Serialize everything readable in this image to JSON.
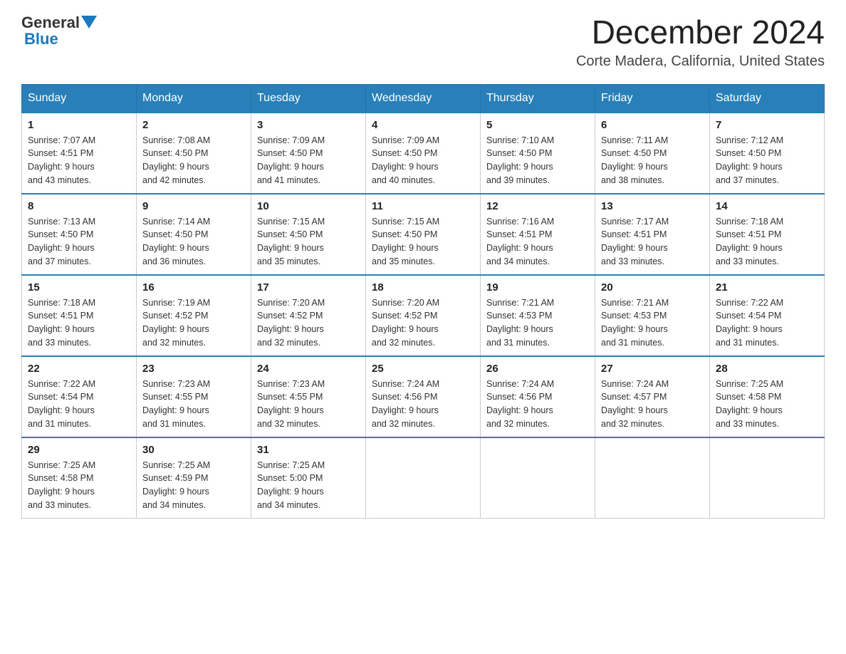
{
  "header": {
    "logo_general": "General",
    "logo_blue": "Blue",
    "main_title": "December 2024",
    "subtitle": "Corte Madera, California, United States"
  },
  "weekdays": [
    "Sunday",
    "Monday",
    "Tuesday",
    "Wednesday",
    "Thursday",
    "Friday",
    "Saturday"
  ],
  "weeks": [
    [
      {
        "day": "1",
        "sunrise": "7:07 AM",
        "sunset": "4:51 PM",
        "daylight": "9 hours and 43 minutes."
      },
      {
        "day": "2",
        "sunrise": "7:08 AM",
        "sunset": "4:50 PM",
        "daylight": "9 hours and 42 minutes."
      },
      {
        "day": "3",
        "sunrise": "7:09 AM",
        "sunset": "4:50 PM",
        "daylight": "9 hours and 41 minutes."
      },
      {
        "day": "4",
        "sunrise": "7:09 AM",
        "sunset": "4:50 PM",
        "daylight": "9 hours and 40 minutes."
      },
      {
        "day": "5",
        "sunrise": "7:10 AM",
        "sunset": "4:50 PM",
        "daylight": "9 hours and 39 minutes."
      },
      {
        "day": "6",
        "sunrise": "7:11 AM",
        "sunset": "4:50 PM",
        "daylight": "9 hours and 38 minutes."
      },
      {
        "day": "7",
        "sunrise": "7:12 AM",
        "sunset": "4:50 PM",
        "daylight": "9 hours and 37 minutes."
      }
    ],
    [
      {
        "day": "8",
        "sunrise": "7:13 AM",
        "sunset": "4:50 PM",
        "daylight": "9 hours and 37 minutes."
      },
      {
        "day": "9",
        "sunrise": "7:14 AM",
        "sunset": "4:50 PM",
        "daylight": "9 hours and 36 minutes."
      },
      {
        "day": "10",
        "sunrise": "7:15 AM",
        "sunset": "4:50 PM",
        "daylight": "9 hours and 35 minutes."
      },
      {
        "day": "11",
        "sunrise": "7:15 AM",
        "sunset": "4:50 PM",
        "daylight": "9 hours and 35 minutes."
      },
      {
        "day": "12",
        "sunrise": "7:16 AM",
        "sunset": "4:51 PM",
        "daylight": "9 hours and 34 minutes."
      },
      {
        "day": "13",
        "sunrise": "7:17 AM",
        "sunset": "4:51 PM",
        "daylight": "9 hours and 33 minutes."
      },
      {
        "day": "14",
        "sunrise": "7:18 AM",
        "sunset": "4:51 PM",
        "daylight": "9 hours and 33 minutes."
      }
    ],
    [
      {
        "day": "15",
        "sunrise": "7:18 AM",
        "sunset": "4:51 PM",
        "daylight": "9 hours and 33 minutes."
      },
      {
        "day": "16",
        "sunrise": "7:19 AM",
        "sunset": "4:52 PM",
        "daylight": "9 hours and 32 minutes."
      },
      {
        "day": "17",
        "sunrise": "7:20 AM",
        "sunset": "4:52 PM",
        "daylight": "9 hours and 32 minutes."
      },
      {
        "day": "18",
        "sunrise": "7:20 AM",
        "sunset": "4:52 PM",
        "daylight": "9 hours and 32 minutes."
      },
      {
        "day": "19",
        "sunrise": "7:21 AM",
        "sunset": "4:53 PM",
        "daylight": "9 hours and 31 minutes."
      },
      {
        "day": "20",
        "sunrise": "7:21 AM",
        "sunset": "4:53 PM",
        "daylight": "9 hours and 31 minutes."
      },
      {
        "day": "21",
        "sunrise": "7:22 AM",
        "sunset": "4:54 PM",
        "daylight": "9 hours and 31 minutes."
      }
    ],
    [
      {
        "day": "22",
        "sunrise": "7:22 AM",
        "sunset": "4:54 PM",
        "daylight": "9 hours and 31 minutes."
      },
      {
        "day": "23",
        "sunrise": "7:23 AM",
        "sunset": "4:55 PM",
        "daylight": "9 hours and 31 minutes."
      },
      {
        "day": "24",
        "sunrise": "7:23 AM",
        "sunset": "4:55 PM",
        "daylight": "9 hours and 32 minutes."
      },
      {
        "day": "25",
        "sunrise": "7:24 AM",
        "sunset": "4:56 PM",
        "daylight": "9 hours and 32 minutes."
      },
      {
        "day": "26",
        "sunrise": "7:24 AM",
        "sunset": "4:56 PM",
        "daylight": "9 hours and 32 minutes."
      },
      {
        "day": "27",
        "sunrise": "7:24 AM",
        "sunset": "4:57 PM",
        "daylight": "9 hours and 32 minutes."
      },
      {
        "day": "28",
        "sunrise": "7:25 AM",
        "sunset": "4:58 PM",
        "daylight": "9 hours and 33 minutes."
      }
    ],
    [
      {
        "day": "29",
        "sunrise": "7:25 AM",
        "sunset": "4:58 PM",
        "daylight": "9 hours and 33 minutes."
      },
      {
        "day": "30",
        "sunrise": "7:25 AM",
        "sunset": "4:59 PM",
        "daylight": "9 hours and 34 minutes."
      },
      {
        "day": "31",
        "sunrise": "7:25 AM",
        "sunset": "5:00 PM",
        "daylight": "9 hours and 34 minutes."
      },
      null,
      null,
      null,
      null
    ]
  ],
  "labels": {
    "sunrise": "Sunrise: ",
    "sunset": "Sunset: ",
    "daylight": "Daylight: "
  }
}
